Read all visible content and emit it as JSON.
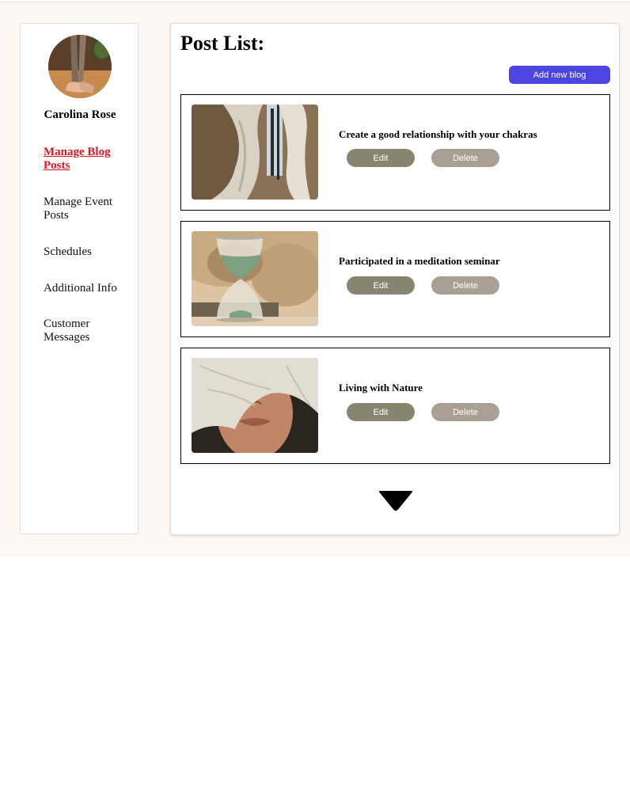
{
  "sidebar": {
    "user_name": "Carolina Rose",
    "items": [
      {
        "label": "Manage Blog Posts",
        "active": true
      },
      {
        "label": "Manage Event Posts",
        "active": false
      },
      {
        "label": "Schedules",
        "active": false
      },
      {
        "label": "Additional Info",
        "active": false
      },
      {
        "label": "Customer Messages",
        "active": false
      }
    ]
  },
  "main": {
    "title": "Post List:",
    "add_button_label": "Add new blog",
    "posts": [
      {
        "title": "Create a good relationship with your chakras",
        "edit_label": "Edit",
        "delete_label": "Delete"
      },
      {
        "title": "Participated in a meditation seminar",
        "edit_label": "Edit",
        "delete_label": "Delete"
      },
      {
        "title": "Living with Nature",
        "edit_label": "Edit",
        "delete_label": "Delete"
      }
    ],
    "load_more_icon": "triangle-down-icon"
  },
  "colors": {
    "active_nav": "#e3141f",
    "add_button": "#4c45e0",
    "edit_button": "#87846f",
    "delete_button": "#a99f95",
    "page_background": "#fdf8f4"
  }
}
